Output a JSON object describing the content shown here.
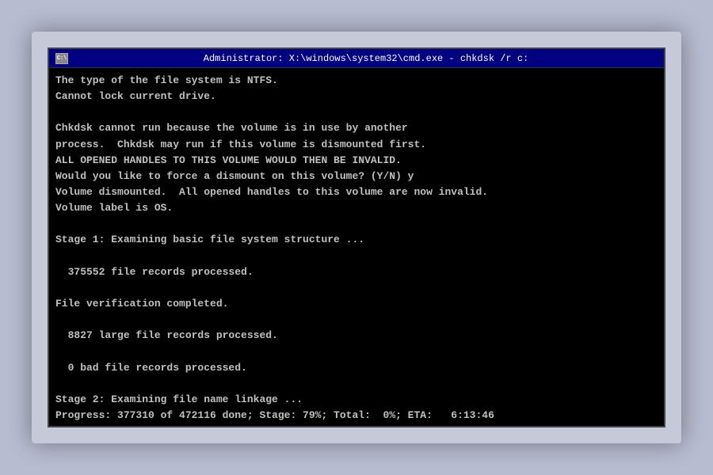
{
  "window": {
    "title": "Administrator: X:\\windows\\system32\\cmd.exe - chkdsk /r c:",
    "icon_label": "C:\\",
    "body_lines": [
      "The type of the file system is NTFS.",
      "Cannot lock current drive.",
      "",
      "Chkdsk cannot run because the volume is in use by another",
      "process.  Chkdsk may run if this volume is dismounted first.",
      "ALL OPENED HANDLES TO THIS VOLUME WOULD THEN BE INVALID.",
      "Would you like to force a dismount on this volume? (Y/N) y",
      "Volume dismounted.  All opened handles to this volume are now invalid.",
      "Volume label is OS.",
      "",
      "Stage 1: Examining basic file system structure ...",
      "",
      "  375552 file records processed.",
      "",
      "File verification completed.",
      "",
      "  8827 large file records processed.",
      "",
      "  0 bad file records processed.",
      "",
      "Stage 2: Examining file name linkage ...",
      "Progress: 377310 of 472116 done; Stage: 79%; Total:  0%; ETA:   6:13:46"
    ]
  }
}
